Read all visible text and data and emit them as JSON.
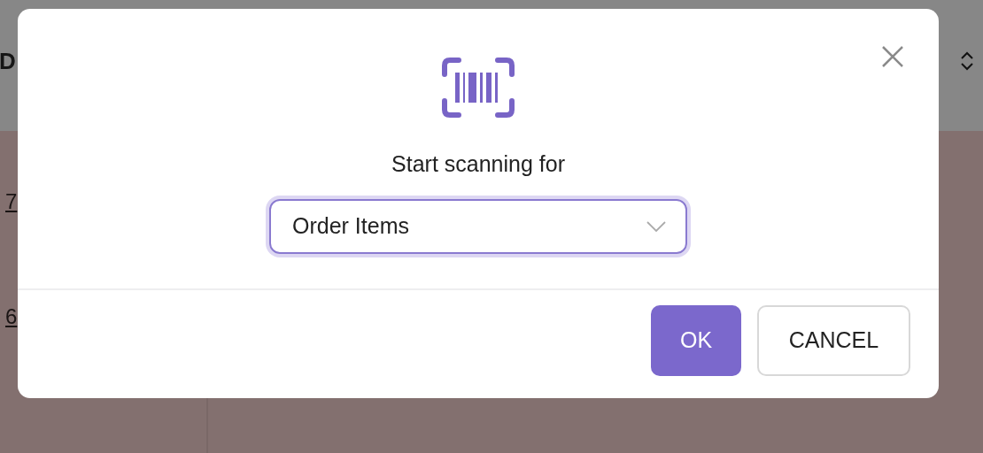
{
  "background": {
    "header_text": "D",
    "links": [
      "7",
      "6"
    ]
  },
  "dialog": {
    "title": "Start scanning for",
    "select": {
      "value": "Order Items",
      "focused": true
    },
    "buttons": [
      {
        "label": "OK",
        "kind": "primary"
      },
      {
        "label": "CANCEL",
        "kind": "secondary"
      }
    ]
  }
}
